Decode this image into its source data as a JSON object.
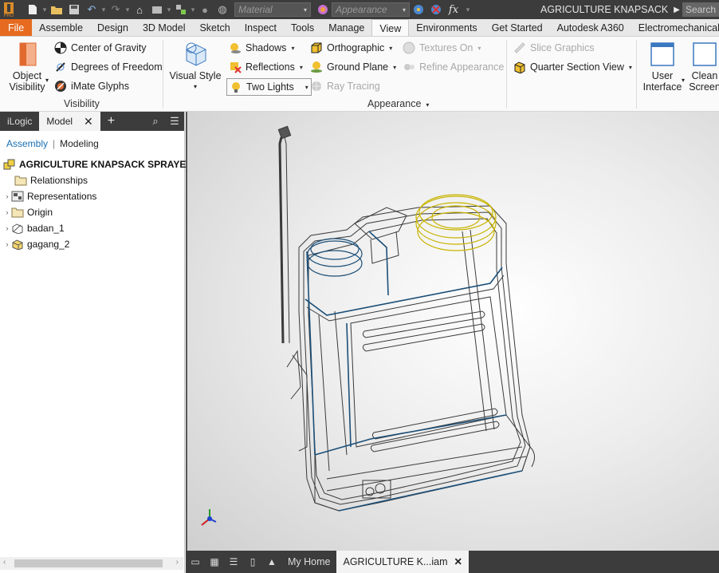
{
  "quick_access": {
    "material_placeholder": "Material",
    "appearance_placeholder": "Appearance",
    "fx_label": "fx",
    "document_title": "AGRICULTURE KNAPSACK ...",
    "search_placeholder": "Search"
  },
  "ribbon_tabs": [
    "File",
    "Assemble",
    "Design",
    "3D Model",
    "Sketch",
    "Inspect",
    "Tools",
    "Manage",
    "View",
    "Environments",
    "Get Started",
    "Autodesk A360",
    "Electromechanical"
  ],
  "active_tab": "View",
  "ribbon": {
    "visibility": {
      "object_visibility": "Object\nVisibility",
      "object_visibility_l1": "Object",
      "object_visibility_l2": "Visibility",
      "center_of_gravity": "Center of Gravity",
      "degrees_of_freedom": "Degrees of Freedom",
      "imate_glyphs": "iMate Glyphs",
      "panel_label": "Visibility"
    },
    "appearance": {
      "visual_style": "Visual Style",
      "shadows": "Shadows",
      "reflections": "Reflections",
      "two_lights": "Two Lights",
      "orthographic": "Orthographic",
      "ground_plane": "Ground Plane",
      "ray_tracing": "Ray Tracing",
      "textures_on": "Textures On",
      "refine_appearance": "Refine Appearance",
      "slice_graphics": "Slice Graphics",
      "quarter_section_view": "Quarter Section View",
      "panel_label": "Appearance"
    },
    "windows": {
      "user_interface_l1": "User",
      "user_interface_l2": "Interface",
      "clean_screen_l1": "Clean",
      "clean_screen_l2": "Screen"
    }
  },
  "browser": {
    "tabs": [
      "iLogic",
      "Model"
    ],
    "filter_assembly": "Assembly",
    "filter_modeling": "Modeling",
    "root": "AGRICULTURE KNAPSACK SPRAYER.iam",
    "items": [
      {
        "label": "Relationships",
        "icon": "folder-icon",
        "expandable": false
      },
      {
        "label": "Representations",
        "icon": "representations-icon",
        "expandable": true
      },
      {
        "label": "Origin",
        "icon": "folder-icon",
        "expandable": true
      },
      {
        "label": "badan_1",
        "icon": "part-icon",
        "expandable": true
      },
      {
        "label": "gagang_2",
        "icon": "part-icon",
        "expandable": true
      }
    ]
  },
  "document_tabs": {
    "home": "My Home",
    "active": "AGRICULTURE K...iam"
  },
  "colors": {
    "file_tab": "#e66a1f",
    "dark_bar": "#3c3c3c",
    "link_blue": "#1a6fb5",
    "wire_dark": "#3a3a3a",
    "wire_blue": "#1c4f78",
    "selected_cap": "#c8b400"
  }
}
